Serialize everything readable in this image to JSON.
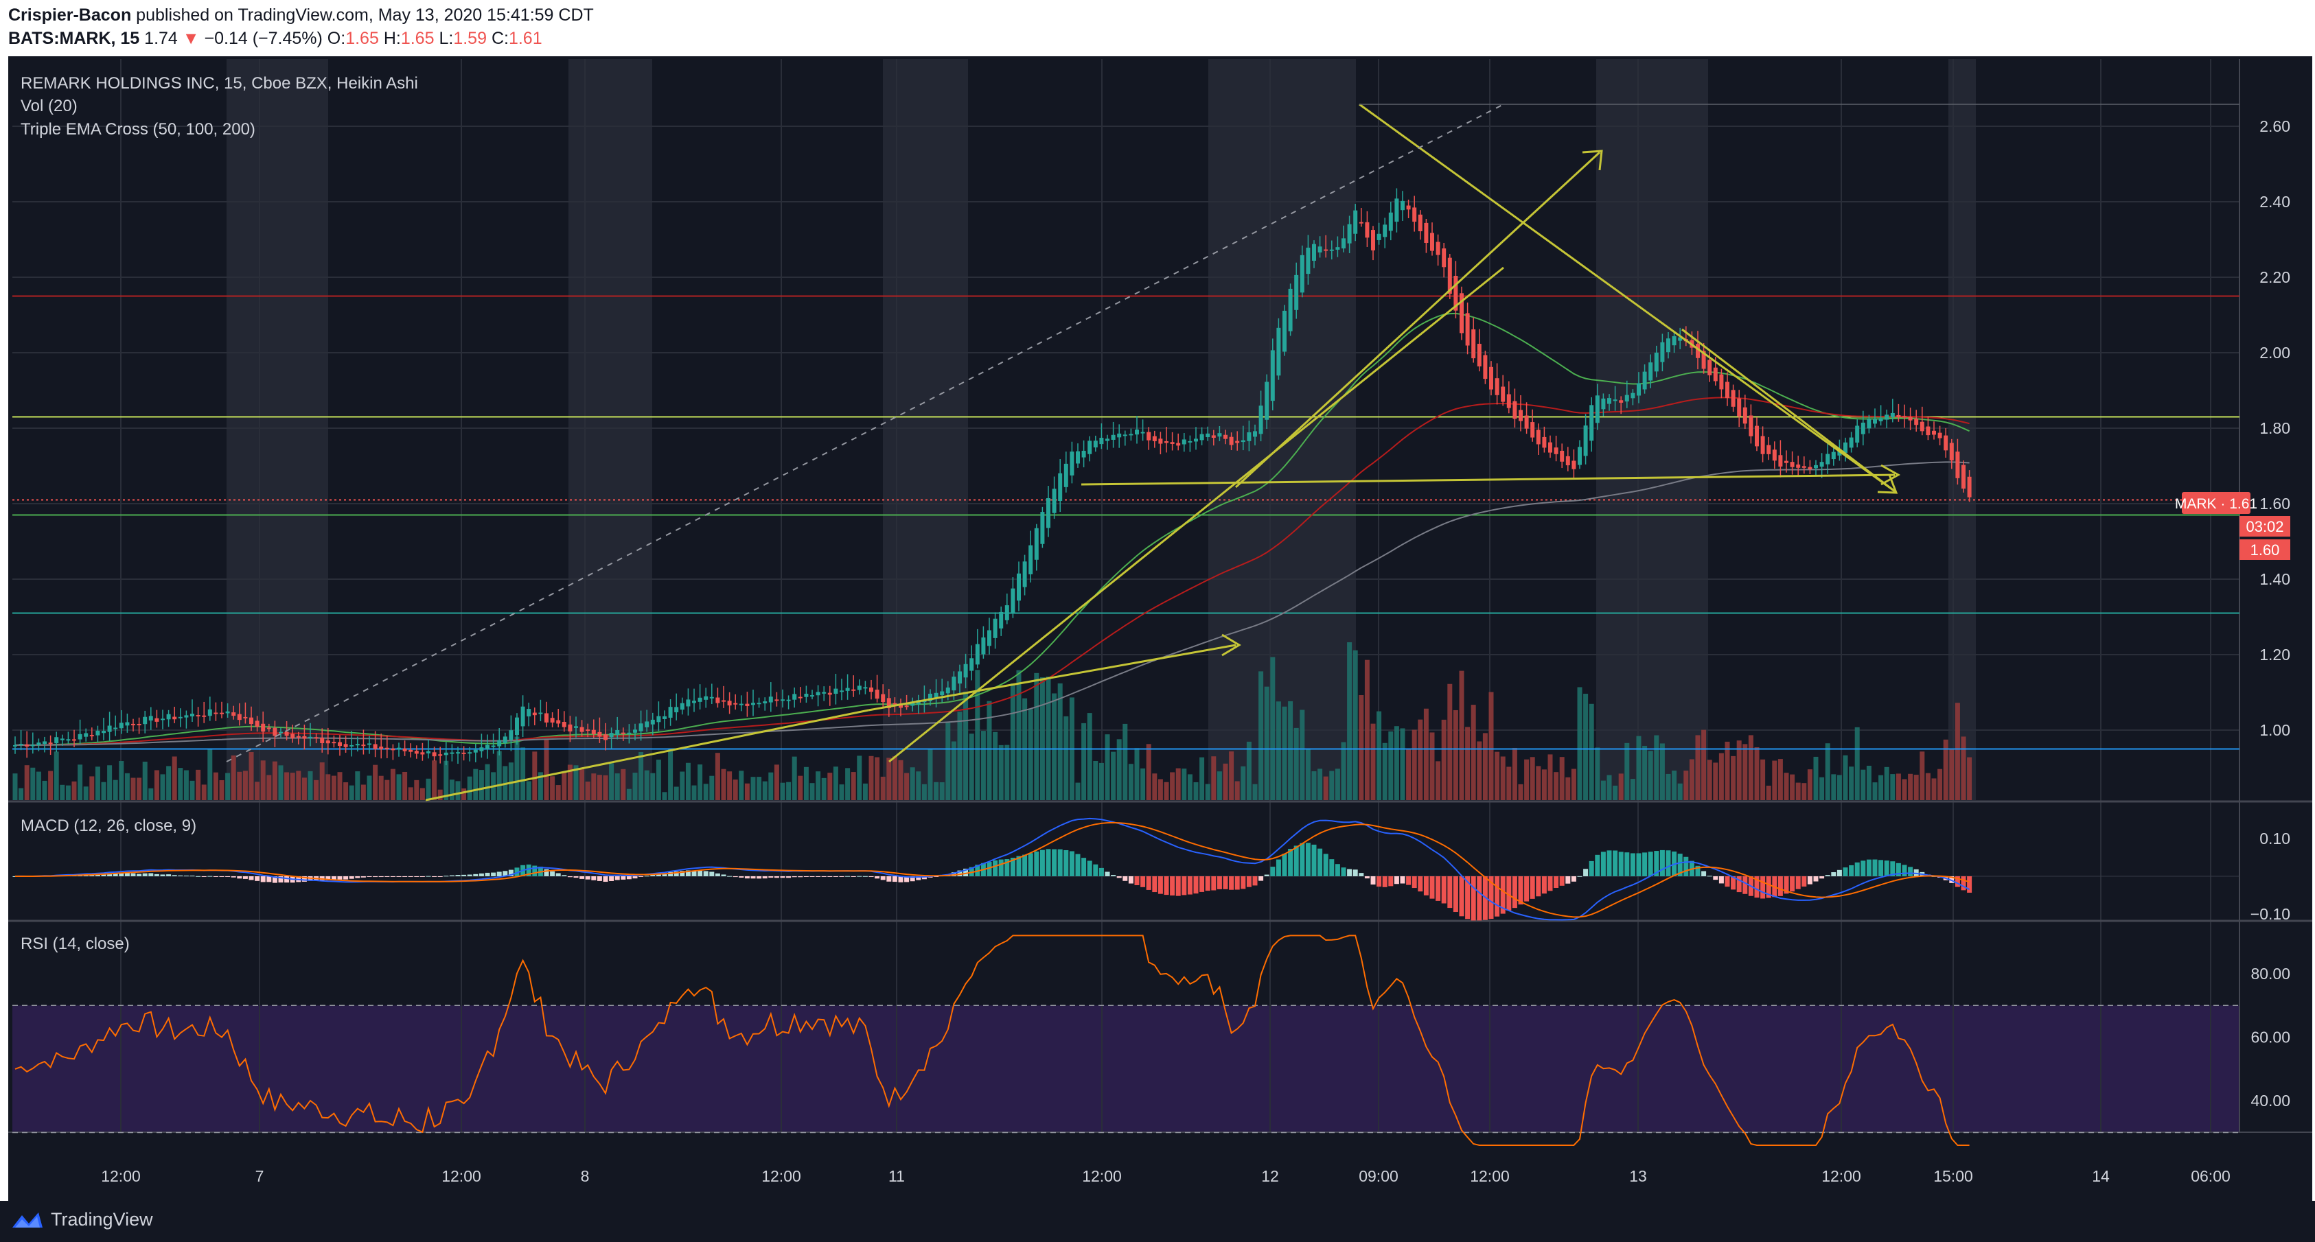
{
  "header": {
    "author": "Crispier-Bacon",
    "published_text": "published on TradingView.com, May 13, 2020 15:41:59 CDT",
    "symbol_prefix": "BATS:MARK, 15",
    "price": "1.74",
    "change": "−0.14 (−7.45%)",
    "o_label": "O:",
    "o_val": "1.65",
    "h_label": "H:",
    "h_val": "1.65",
    "l_label": "L:",
    "l_val": "1.59",
    "c_label": "C:",
    "c_val": "1.61"
  },
  "legend": {
    "title": "REMARK HOLDINGS INC, 15, Cboe BZX, Heikin Ashi",
    "vol": "Vol (20)",
    "ema": "Triple EMA Cross (50, 100, 200)",
    "macd": "MACD (12, 26, close, 9)",
    "rsi": "RSI (14, close)"
  },
  "price_axis": [
    "2.60",
    "2.40",
    "2.20",
    "2.00",
    "1.80",
    "1.60",
    "1.40",
    "1.20",
    "1.00"
  ],
  "macd_axis": [
    "0.10",
    "−0.10"
  ],
  "rsi_axis": [
    "80.00",
    "60.00",
    "40.00"
  ],
  "time_axis": [
    "12:00",
    "7",
    "12:00",
    "8",
    "12:00",
    "11",
    "12:00",
    "12",
    "09:00",
    "12:00",
    "13",
    "12:00",
    "15:00",
    "14",
    "06:00"
  ],
  "badges": {
    "mark": "MARK · 1.61",
    "countdown": "03:02",
    "close": "1.60"
  },
  "footer": {
    "brand": "TradingView"
  },
  "colors": {
    "bg": "#131722",
    "up": "#26a69a",
    "down": "#ef5350",
    "annotation": "#c5c536",
    "ema50": "#4caf50",
    "ema100": "#b71c1c",
    "ema200": "#787b86",
    "macd": "#2962ff",
    "signal": "#ff6d00",
    "rsi": "#ff6d00",
    "rsi_band": "#2a1e4a"
  },
  "chart_data": [
    {
      "type": "candlestick",
      "title": "REMARK HOLDINGS INC, 15, Cboe BZX, Heikin Ashi",
      "ylim": [
        0.9,
        2.7
      ],
      "x": [
        "12:00",
        "7",
        "12:00",
        "8",
        "12:00",
        "11",
        "12:00",
        "12",
        "09:00",
        "12:00",
        "13",
        "12:00",
        "15:00",
        "14",
        "06:00"
      ],
      "series": [
        {
          "name": "Heikin Ashi close",
          "values": [
            0.96,
            1.02,
            0.99,
            0.93,
            0.98,
            1.06,
            1.1,
            1.06,
            1.12,
            1.34,
            1.73,
            1.79,
            1.76,
            2.28,
            2.42,
            2.24,
            1.87,
            1.77,
            2.03,
            1.92,
            1.7,
            1.77,
            1.83,
            1.61
          ]
        }
      ],
      "horizontal_levels": [
        2.15,
        1.83,
        1.61,
        1.57,
        1.31,
        0.95
      ],
      "last_price": 1.61
    },
    {
      "type": "bar",
      "title": "Vol (20)",
      "series": [
        {
          "name": "Vol",
          "values": [
            0.3,
            0.5,
            0.2,
            0.15,
            0.3,
            0.25,
            0.2,
            0.3,
            0.45,
            0.6,
            0.85,
            0.8,
            0.7,
            1.0,
            0.75,
            0.5,
            0.6,
            0.35,
            0.4,
            0.15,
            0.15,
            0.2,
            0.15,
            0.1
          ]
        }
      ]
    },
    {
      "type": "line",
      "title": "MACD (12, 26, close, 9)",
      "ylim": [
        -0.12,
        0.12
      ],
      "series": [
        {
          "name": "MACD",
          "values": [
            0.0,
            0.07,
            0.01,
            -0.02,
            0.0,
            0.0,
            0.0,
            0.0,
            0.0,
            0.03,
            0.11,
            0.08,
            0.02,
            0.11,
            0.1,
            0.0,
            -0.1,
            -0.06,
            0.02,
            -0.02,
            -0.08,
            -0.04,
            -0.03,
            -0.06
          ]
        },
        {
          "name": "Signal",
          "values": [
            0.0,
            0.05,
            0.02,
            -0.01,
            0.0,
            0.0,
            0.0,
            0.0,
            0.0,
            0.02,
            0.09,
            0.09,
            0.05,
            0.09,
            0.11,
            0.03,
            -0.06,
            -0.07,
            0.0,
            -0.01,
            -0.06,
            -0.05,
            -0.03,
            -0.04
          ]
        }
      ]
    },
    {
      "type": "line",
      "title": "RSI (14, close)",
      "ylim": [
        25,
        95
      ],
      "series": [
        {
          "name": "RSI",
          "values": [
            56,
            80,
            47,
            48,
            74,
            46,
            67,
            52,
            50,
            62,
            90,
            78,
            52,
            80,
            72,
            44,
            30,
            52,
            55,
            36,
            30,
            52,
            44,
            27
          ]
        }
      ]
    }
  ]
}
